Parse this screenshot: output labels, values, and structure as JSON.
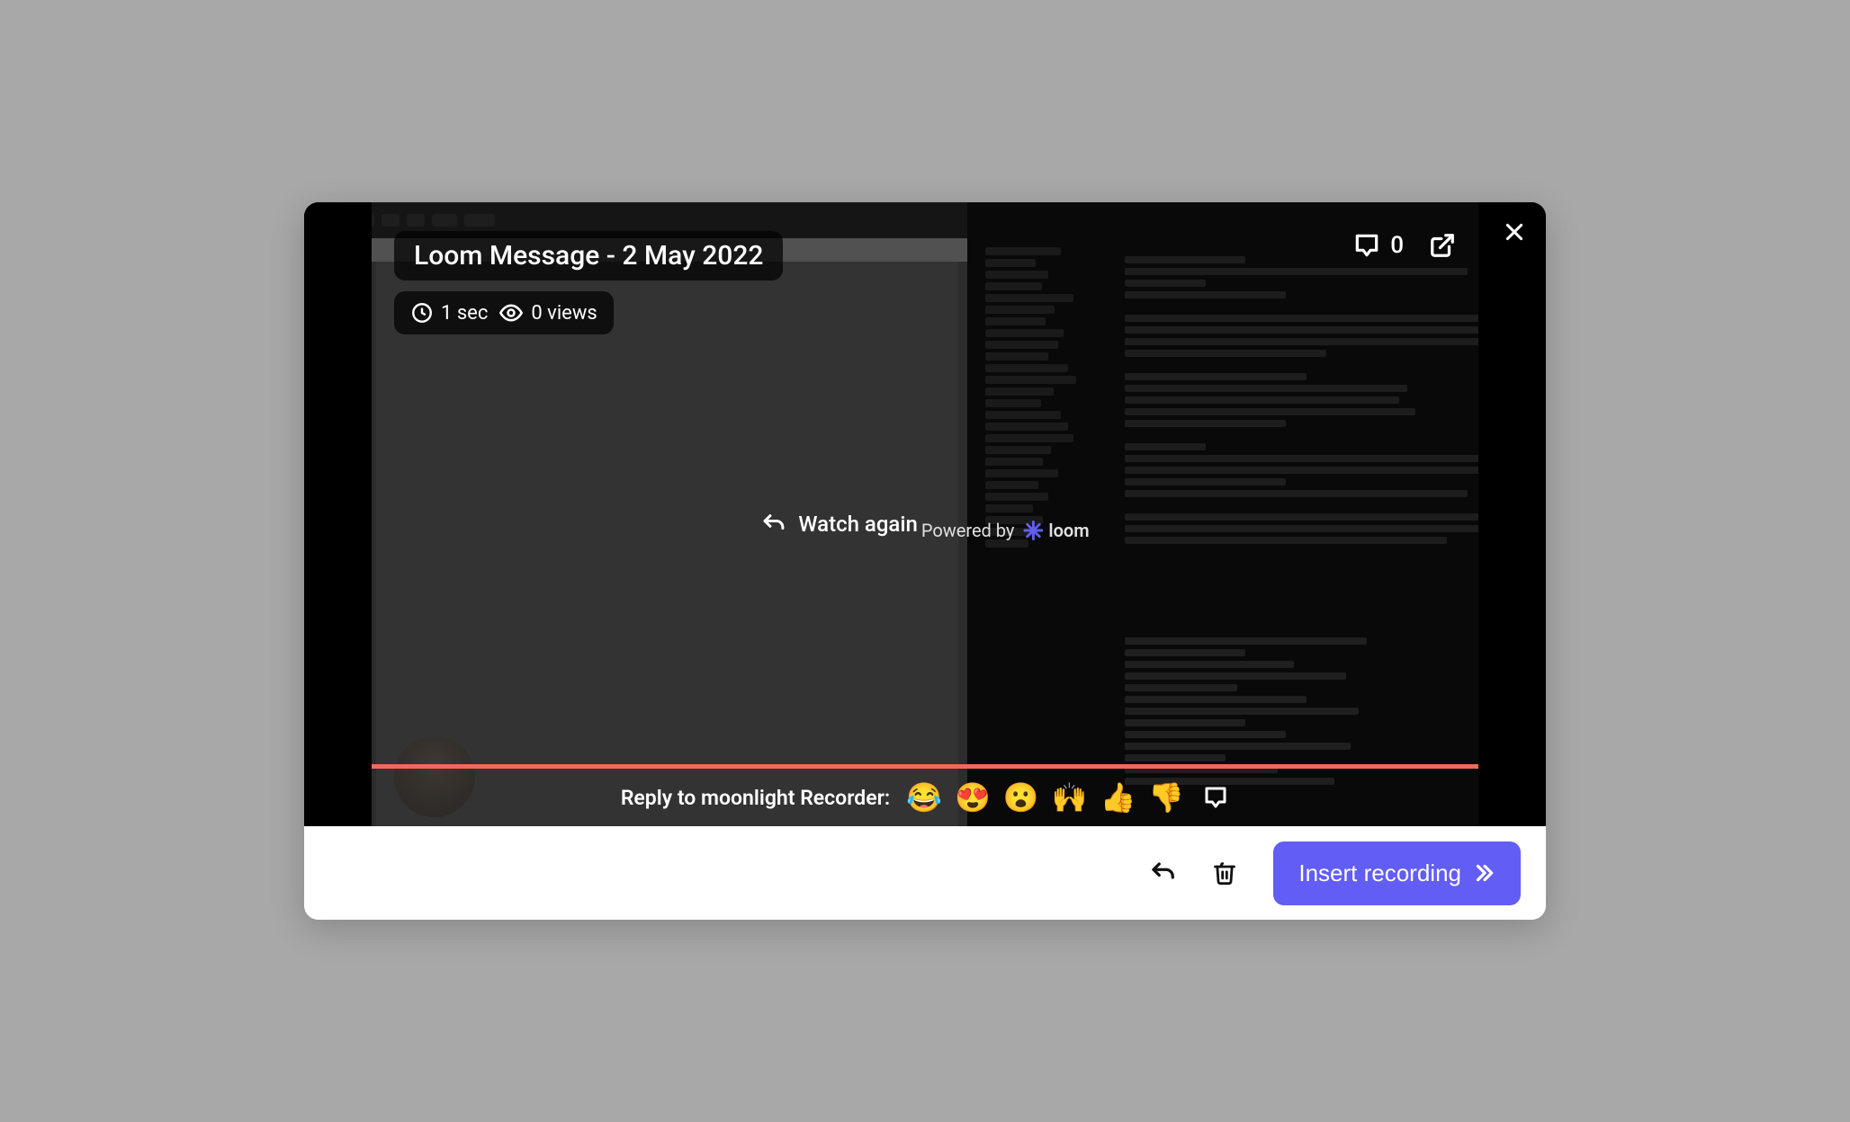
{
  "video": {
    "title": "Loom Message - 2 May 2022",
    "duration": "1 sec",
    "views": "0 views",
    "comments_count": "0"
  },
  "center": {
    "watch_again": "Watch again",
    "powered_by_prefix": "Powered by",
    "brand": "loom"
  },
  "reaction": {
    "prompt": "Reply to moonlight Recorder:",
    "emojis": [
      "😂",
      "😍",
      "😮",
      "🙌",
      "👍",
      "👎"
    ]
  },
  "footer": {
    "insert_label": "Insert recording"
  },
  "colors": {
    "accent": "#625df5",
    "progress": "#ef6a5a"
  }
}
